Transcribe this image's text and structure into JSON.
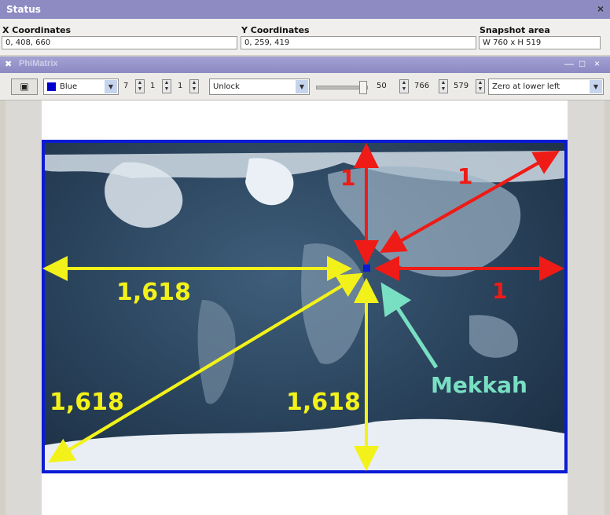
{
  "status": {
    "title": "Status",
    "close": "×",
    "x": {
      "label": "X Coordinates",
      "value": "0, 408, 660"
    },
    "y": {
      "label": "Y Coordinates",
      "value": "0, 259, 419"
    },
    "snapshot": {
      "label": "Snapshot area",
      "value": "W 760 x H 519"
    }
  },
  "window": {
    "title": "PhiMatrix",
    "controls": [
      "—",
      "□",
      "×"
    ]
  },
  "toolbar": {
    "color": "Blue",
    "color_hex": "#0000cc",
    "n1": "7",
    "n2": "1",
    "n3": "1",
    "lock": "Unlock",
    "opacity": "50",
    "width": "766",
    "height": "579",
    "origin": "Zero at lower left"
  },
  "annotations": {
    "red_top": "1",
    "red_diag": "1",
    "red_right": "1",
    "yellow_left": "1,618",
    "yellow_diag": "1,618",
    "yellow_bottom": "1,618",
    "city": "Mekkah"
  },
  "colors": {
    "red": "#ef1b16",
    "yellow": "#f2f21a",
    "mint": "#79dfc3",
    "frame": "#0a1bd4"
  }
}
